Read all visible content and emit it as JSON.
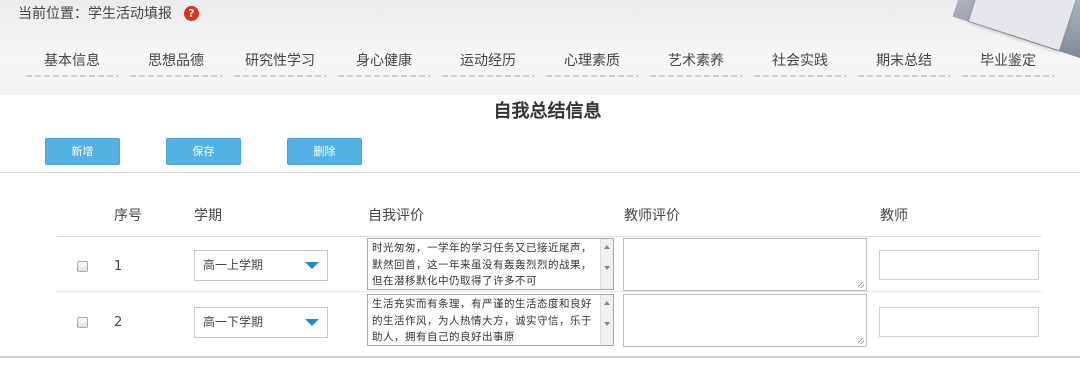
{
  "breadcrumb": {
    "text": "当前位置：学生活动填报",
    "help_icon": "?"
  },
  "tabs": [
    "基本信息",
    "思想品德",
    "研究性学习",
    "身心健康",
    "运动经历",
    "心理素质",
    "艺术素养",
    "社会实践",
    "期末总结",
    "毕业鉴定"
  ],
  "page_title": "自我总结信息",
  "toolbar": {
    "add_label": "新增",
    "save_label": "保存",
    "delete_label": "删除"
  },
  "colors": {
    "button": "#55b0e4",
    "help_icon": "#d9331f",
    "select_arrow": "#1e8ad6"
  },
  "table": {
    "headers": {
      "seq": "序号",
      "term": "学期",
      "self_eval": "自我评价",
      "teacher_eval": "教师评价",
      "teacher": "教师"
    },
    "rows": [
      {
        "seq": "1",
        "term": "高一上学期",
        "self_eval": "时光匆匆，一学年的学习任务又已接近尾声，默然回首，这一年来虽没有轰轰烈烈的战果，但在潜移默化中仍取得了许多不可",
        "teacher_eval": "",
        "teacher": ""
      },
      {
        "seq": "2",
        "term": "高一下学期",
        "self_eval": "生活充实而有条理，有严谨的生活态度和良好的生活作风，为人热情大方，诚实守信，乐于助人，拥有自己的良好出事原",
        "teacher_eval": "",
        "teacher": ""
      }
    ]
  }
}
